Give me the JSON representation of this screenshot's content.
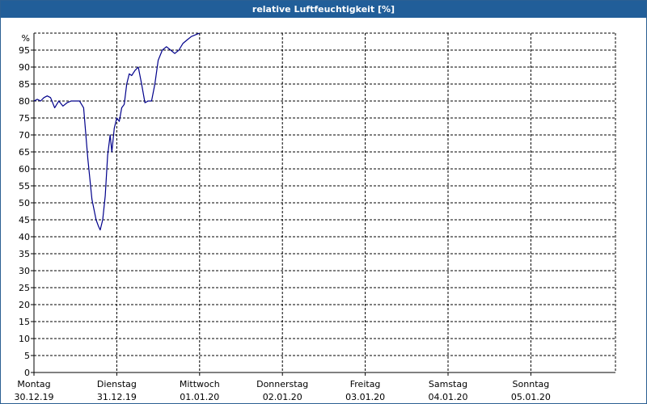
{
  "chart_data": {
    "type": "line",
    "title": "relative Luftfeuchtigkeit [%]",
    "y_unit_label": "%",
    "ylim": [
      0,
      100
    ],
    "y_ticks": [
      0,
      5,
      10,
      15,
      20,
      25,
      30,
      35,
      40,
      45,
      50,
      55,
      60,
      65,
      70,
      75,
      80,
      85,
      90,
      95
    ],
    "xlim": [
      0,
      7
    ],
    "x_ticks": [
      {
        "day": "Montag",
        "date": "30.12.19"
      },
      {
        "day": "Dienstag",
        "date": "31.12.19"
      },
      {
        "day": "Mittwoch",
        "date": "01.01.20"
      },
      {
        "day": "Donnerstag",
        "date": "02.01.20"
      },
      {
        "day": "Freitag",
        "date": "03.01.20"
      },
      {
        "day": "Samstag",
        "date": "04.01.20"
      },
      {
        "day": "Sonntag",
        "date": "05.01.20"
      }
    ],
    "grid": true,
    "line_color": "#00008b",
    "series": [
      {
        "x": [
          0,
          0.04,
          0.08,
          0.12,
          0.16,
          0.2,
          0.25,
          0.3,
          0.35,
          0.4,
          0.45,
          0.5,
          0.55,
          0.6,
          0.65,
          0.7,
          0.75,
          0.78,
          0.8,
          0.83,
          0.86,
          0.89,
          0.92,
          0.94,
          0.97,
          1.0,
          1.03,
          1.06,
          1.09,
          1.12,
          1.15,
          1.18,
          1.22,
          1.26,
          1.3,
          1.34,
          1.38,
          1.42,
          1.46,
          1.5,
          1.55,
          1.6,
          1.65,
          1.7,
          1.75,
          1.8,
          1.85,
          1.9,
          1.95,
          2.0
        ],
        "y": [
          80,
          80.5,
          80,
          81,
          81.5,
          81,
          78,
          80,
          78.5,
          79.5,
          80,
          80,
          80,
          78,
          63,
          51,
          45,
          43,
          42,
          45,
          52,
          64,
          70,
          65,
          72,
          75,
          74,
          78,
          79,
          85,
          88,
          87.5,
          89,
          90,
          85,
          79.5,
          80,
          80,
          85,
          92,
          95,
          96,
          95,
          94,
          95,
          97,
          98,
          99,
          99.5,
          100
        ]
      }
    ]
  }
}
